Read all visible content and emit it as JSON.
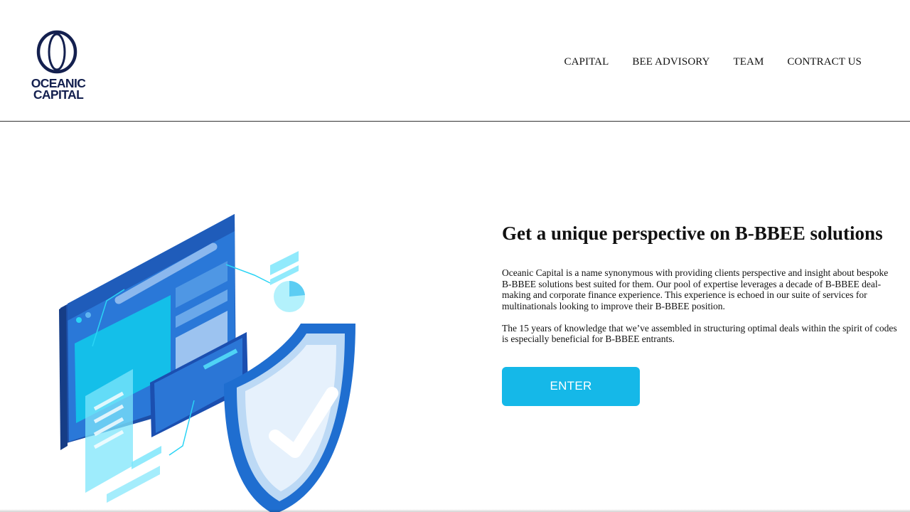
{
  "logo": {
    "line1": "OCEANIC",
    "line2": "CAPITAL",
    "color": "#14204f"
  },
  "nav": {
    "items": [
      {
        "label": "CAPITAL"
      },
      {
        "label": "BEE ADVISORY"
      },
      {
        "label": "TEAM"
      },
      {
        "label": "CONTRACT US"
      }
    ]
  },
  "hero": {
    "illustration": "security-shield-browser-illustration",
    "headline": "Get a unique perspective on B-BBEE solutions",
    "paragraph1": "Oceanic Capital is a name synonymous with providing clients perspective and insight about bespoke B-BBEE solutions best suited for them. Our pool of expertise leverages a decade of B-BBEE deal-making and corporate finance experience. This experience is echoed in our suite of services for multinationals looking to improve their B-BBEE position.",
    "paragraph2": "The 15 years of knowledge that we’ve assembled in structuring optimal deals within the spirit of codes is especially beneficial for B-BBEE entrants.",
    "enter_label": "ENTER"
  },
  "colors": {
    "accent": "#15b8e8",
    "brand_navy": "#14204f",
    "illustration_blue": "#1f6fd1",
    "illustration_cyan": "#16c4ee"
  }
}
